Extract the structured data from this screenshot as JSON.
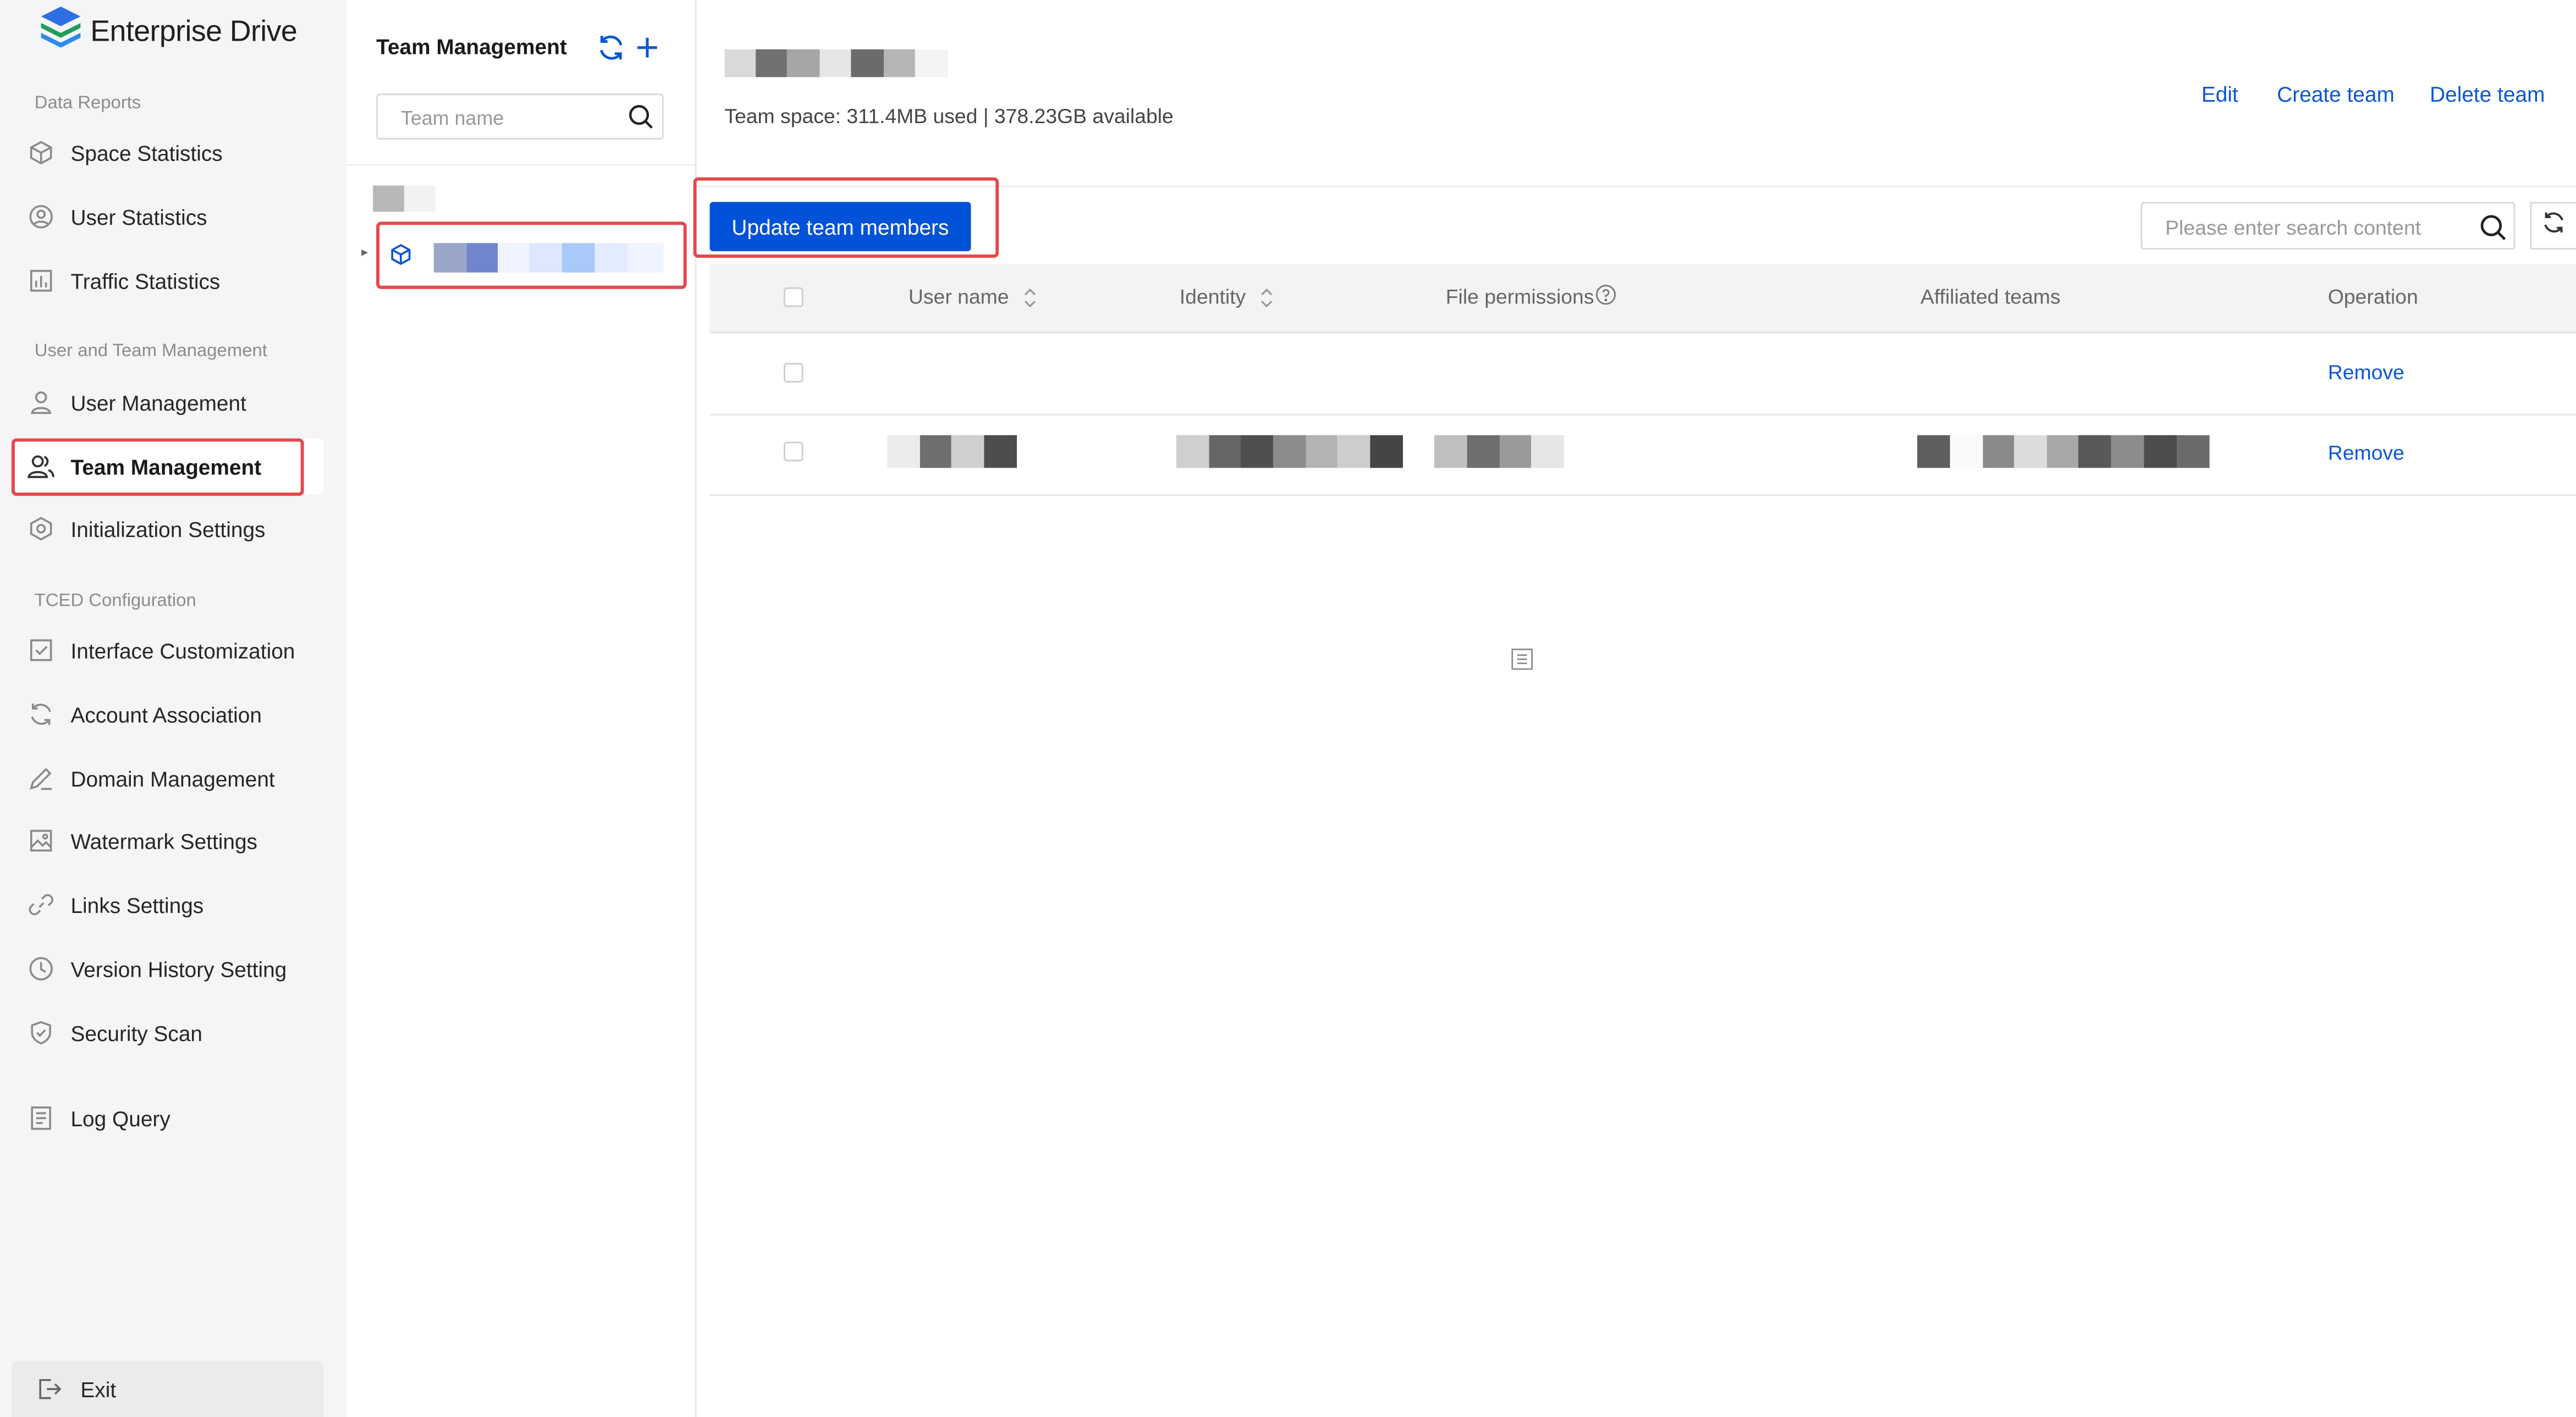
{
  "sidebar": {
    "brand": "Enterprise Drive",
    "sections": [
      {
        "title": "Data Reports",
        "items": [
          {
            "label": "Space Statistics",
            "icon": "cube-icon"
          },
          {
            "label": "User Statistics",
            "icon": "user-circle-icon"
          },
          {
            "label": "Traffic Statistics",
            "icon": "bar-chart-icon"
          }
        ]
      },
      {
        "title": "User and Team Management",
        "items": [
          {
            "label": "User Management",
            "icon": "user-icon"
          },
          {
            "label": "Team Management",
            "icon": "team-icon",
            "active": true
          },
          {
            "label": "Initialization Settings",
            "icon": "hexagon-gear-icon"
          }
        ]
      },
      {
        "title": "TCED Configuration",
        "items": [
          {
            "label": "Interface Customization",
            "icon": "checkbox-icon"
          },
          {
            "label": "Account Association",
            "icon": "sync-icon"
          },
          {
            "label": "Domain Management",
            "icon": "pen-icon"
          },
          {
            "label": "Watermark Settings",
            "icon": "image-icon"
          },
          {
            "label": "Links Settings",
            "icon": "link-icon"
          },
          {
            "label": "Version History Setting",
            "icon": "clock-icon"
          },
          {
            "label": "Security Scan",
            "icon": "shield-check-icon"
          },
          {
            "label": "Log Query",
            "icon": "document-list-icon"
          }
        ]
      }
    ],
    "exit_label": "Exit"
  },
  "team_panel": {
    "title": "Team Management",
    "search_placeholder": "Team name"
  },
  "main": {
    "space_info": "Team space: 311.4MB used | 378.23GB available",
    "actions": {
      "edit": "Edit",
      "create": "Create team",
      "delete": "Delete team"
    },
    "update_button": "Update team members",
    "search_placeholder": "Please enter search content",
    "table": {
      "headers": {
        "user_name": "User name",
        "identity": "Identity",
        "file_permissions": "File permissions",
        "affiliated_teams": "Affiliated teams",
        "operation": "Operation"
      },
      "rows": [
        {
          "operation": "Remove"
        },
        {
          "operation": "Remove"
        }
      ]
    }
  },
  "colors": {
    "accent": "#0052d9",
    "link": "#0b57d0",
    "highlight": "#e5484d",
    "sidebar_bg": "#f5f5f7"
  }
}
